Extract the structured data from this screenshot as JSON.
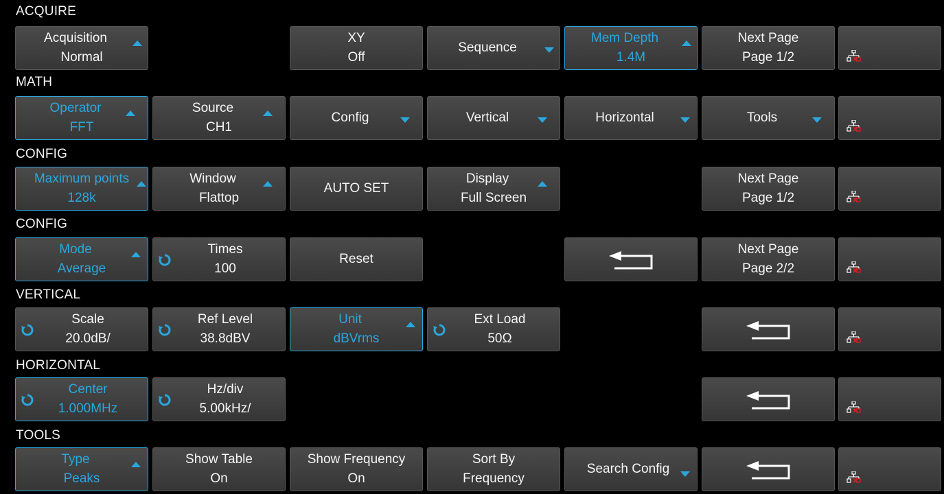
{
  "sections": {
    "acquire": "ACQUIRE",
    "math": "MATH",
    "config1": "CONFIG",
    "config2": "CONFIG",
    "vertical": "VERTICAL",
    "horizontal": "HORIZONTAL",
    "tools": "TOOLS"
  },
  "acquire": {
    "acquisition": {
      "label": "Acquisition",
      "value": "Normal"
    },
    "xy": {
      "label": "XY",
      "value": "Off"
    },
    "sequence": {
      "label": "Sequence"
    },
    "mem_depth": {
      "label": "Mem Depth",
      "value": "1.4M"
    },
    "next_page": {
      "label": "Next Page",
      "value": "Page 1/2"
    }
  },
  "math": {
    "operator": {
      "label": "Operator",
      "value": "FFT"
    },
    "source": {
      "label": "Source",
      "value": "CH1"
    },
    "config": {
      "label": "Config"
    },
    "vertical": {
      "label": "Vertical"
    },
    "horizontal": {
      "label": "Horizontal"
    },
    "tools": {
      "label": "Tools"
    }
  },
  "config1": {
    "max_points": {
      "label": "Maximum points",
      "value": "128k"
    },
    "window": {
      "label": "Window",
      "value": "Flattop"
    },
    "auto_set": {
      "label": "AUTO SET"
    },
    "display": {
      "label": "Display",
      "value": "Full Screen"
    },
    "next_page": {
      "label": "Next Page",
      "value": "Page 1/2"
    }
  },
  "config2": {
    "mode": {
      "label": "Mode",
      "value": "Average"
    },
    "times": {
      "label": "Times",
      "value": "100"
    },
    "reset": {
      "label": "Reset"
    },
    "next_page": {
      "label": "Next Page",
      "value": "Page 2/2"
    }
  },
  "vertical": {
    "scale": {
      "label": "Scale",
      "value": "20.0dB/"
    },
    "ref_level": {
      "label": "Ref Level",
      "value": "38.8dBV"
    },
    "unit": {
      "label": "Unit",
      "value": "dBVrms"
    },
    "ext_load": {
      "label": "Ext Load",
      "value": "50Ω"
    }
  },
  "horizontal": {
    "center": {
      "label": "Center",
      "value": "1.000MHz"
    },
    "hz_div": {
      "label": "Hz/div",
      "value": "5.00kHz/"
    }
  },
  "tools": {
    "type": {
      "label": "Type",
      "value": "Peaks"
    },
    "show_table": {
      "label": "Show Table",
      "value": "On"
    },
    "show_frequency": {
      "label": "Show Frequency",
      "value": "On"
    },
    "sort_by": {
      "label": "Sort By",
      "value": "Frequency"
    },
    "search_config": {
      "label": "Search Config"
    }
  },
  "icons": {
    "arrow": "triangle-arrow-icon",
    "knob": "rotate-knob-icon",
    "back": "return-arrow-icon",
    "network": "network-disconnected-icon"
  },
  "colors": {
    "accent": "#2aa7dd",
    "background": "#000000",
    "button": "#3e3e3e",
    "network_alert": "#e02020"
  }
}
